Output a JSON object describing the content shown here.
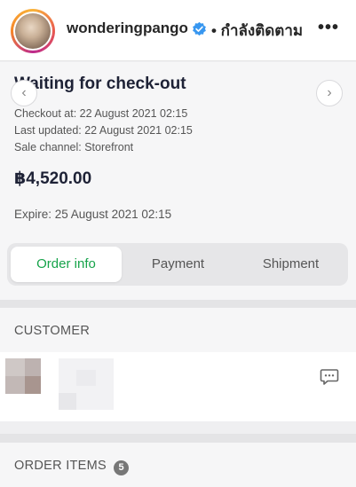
{
  "header": {
    "username": "wonderingpango",
    "follow_status": "• กำลังติดตาม",
    "more_label": "•••"
  },
  "order": {
    "title": "Waiting for check-out",
    "checkout_at": "Checkout at: 22 August 2021 02:15",
    "last_updated": "Last updated: 22 August 2021 02:15",
    "sale_channel": "Sale channel: Storefront",
    "price": "฿4,520.00",
    "expire": "Expire: 25 August 2021 02:15"
  },
  "tabs": [
    {
      "label": "Order info",
      "active": true
    },
    {
      "label": "Payment",
      "active": false
    },
    {
      "label": "Shipment",
      "active": false
    }
  ],
  "nav": {
    "prev": "‹",
    "next": "›"
  },
  "customer": {
    "label": "CUSTOMER"
  },
  "order_items": {
    "label": "ORDER ITEMS",
    "count": "5"
  },
  "colors": {
    "accent": "#16a34a",
    "verified": "#3897f0",
    "title": "#1e2236"
  },
  "icons": [
    "verified-badge-icon",
    "more-icon",
    "chevron-left-icon",
    "chevron-right-icon",
    "chat-icon"
  ]
}
